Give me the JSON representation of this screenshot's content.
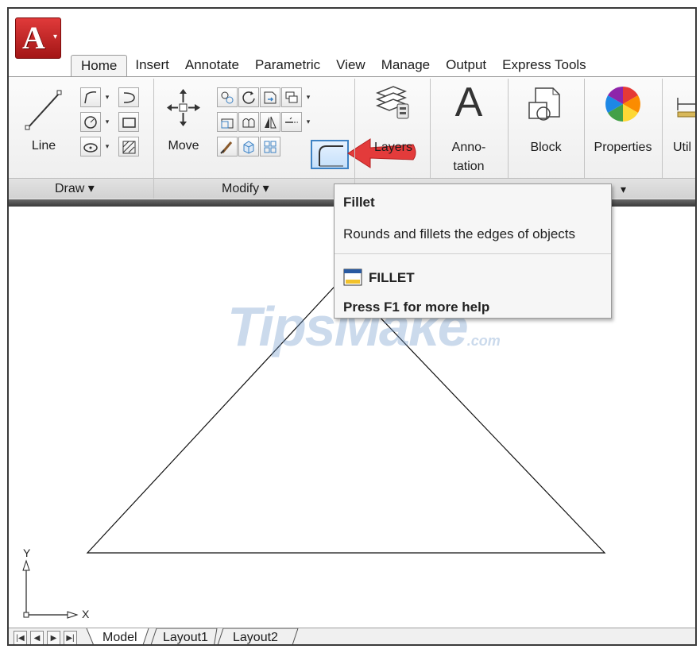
{
  "app": {
    "menu_letter": "A",
    "menu_caret": "▾"
  },
  "tabs": [
    "Home",
    "Insert",
    "Annotate",
    "Parametric",
    "View",
    "Manage",
    "Output",
    "Express Tools"
  ],
  "draw_panel": {
    "line_label": "Line",
    "footer_label": "Draw ▾"
  },
  "modify_panel": {
    "move_label": "Move",
    "footer_label": "Modify ▾"
  },
  "layers": {
    "label": "Layers"
  },
  "annotation": {
    "glyph": "A",
    "label_line1": "Anno-",
    "label_line2": "tation"
  },
  "block": {
    "label": "Block"
  },
  "properties": {
    "label": "Properties"
  },
  "utilities": {
    "label": "Util"
  },
  "panel_dropdown": "▾",
  "tooltip": {
    "title": "Fillet",
    "description": "Rounds and fillets the edges of objects",
    "command": "FILLET",
    "help": "Press F1 for more help"
  },
  "watermark": {
    "main": "TipsMake",
    "suffix": ".com"
  },
  "ucs": {
    "x_label": "X",
    "y_label": "Y"
  },
  "layout_tabs": [
    "Model",
    "Layout1",
    "Layout2"
  ],
  "nav_buttons": [
    "|◀",
    "◀",
    "▶",
    "▶|"
  ],
  "colors": {
    "accent": "#3d82c4",
    "arrow": "#e33b3b",
    "app_button": "#c42020"
  }
}
